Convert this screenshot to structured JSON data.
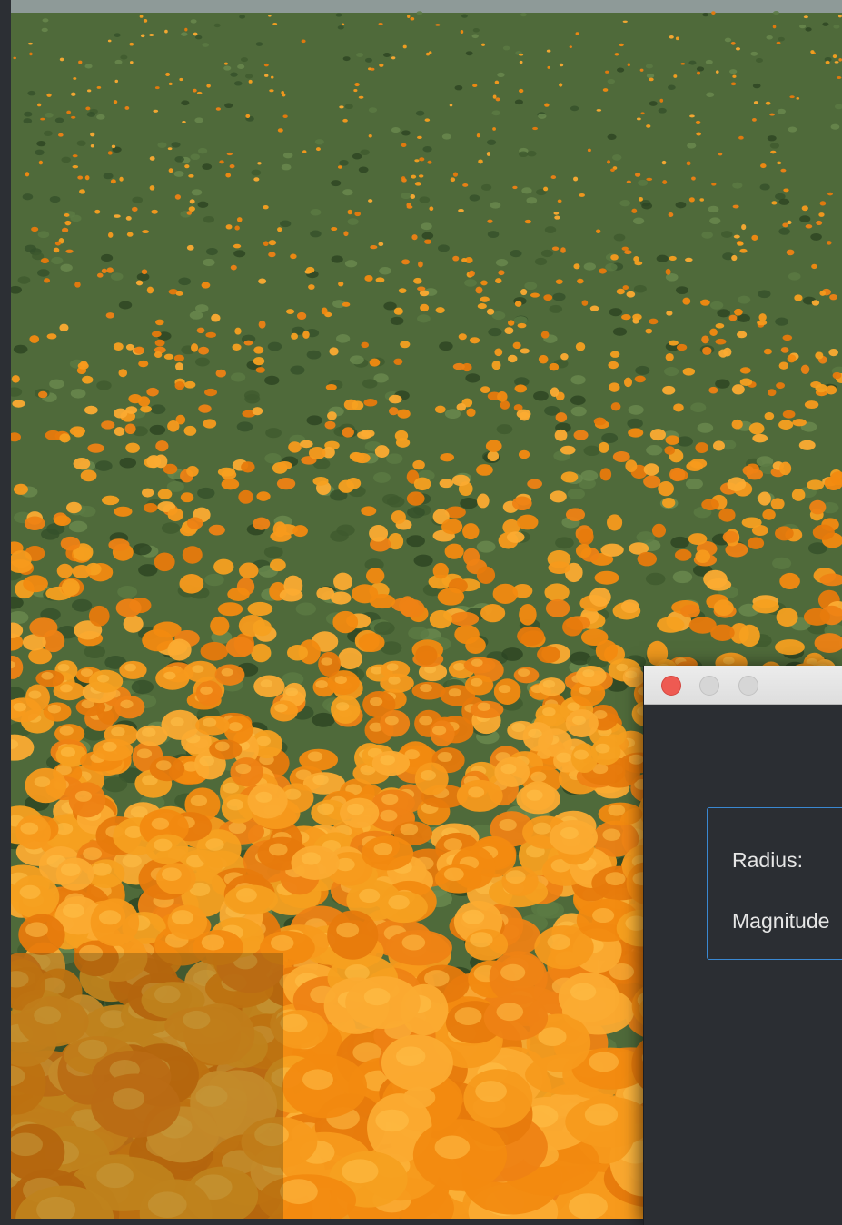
{
  "photo": {
    "subject": "field of orange poppies"
  },
  "dialog": {
    "window_controls": {
      "close": "close-icon",
      "minimize": "minimize-icon",
      "zoom": "zoom-icon"
    },
    "fields": {
      "radius_label": "Radius:",
      "magnitude_label": "Magnitude"
    },
    "colors": {
      "background": "#2b2e33",
      "group_border": "#3a88d2",
      "close_button": "#ee5a52"
    }
  }
}
